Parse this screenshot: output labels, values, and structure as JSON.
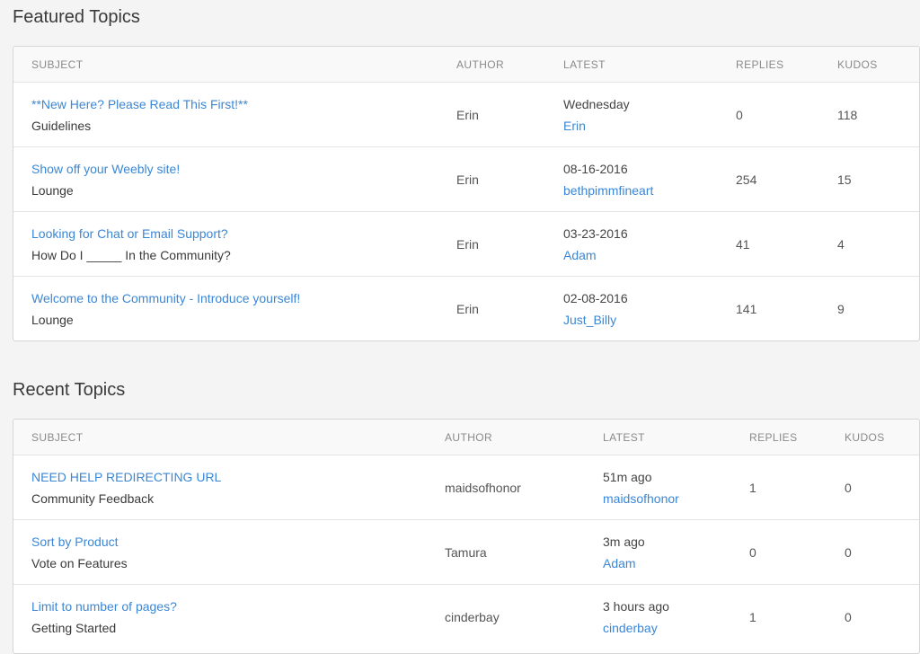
{
  "featured": {
    "title": "Featured Topics",
    "headers": {
      "subject": "SUBJECT",
      "author": "AUTHOR",
      "latest": "LATEST",
      "replies": "REPLIES",
      "kudos": "KUDOS"
    },
    "rows": [
      {
        "subject": "**New Here? Please Read This First!**",
        "board": "Guidelines",
        "author": "Erin",
        "latest_date": "Wednesday",
        "latest_user": "Erin",
        "replies": "0",
        "kudos": "118"
      },
      {
        "subject": "Show off your Weebly site!",
        "board": "Lounge",
        "author": "Erin",
        "latest_date": "08-16-2016",
        "latest_user": "bethpimmfineart",
        "replies": "254",
        "kudos": "15"
      },
      {
        "subject": "Looking for Chat or Email Support?",
        "board": "How Do I _____ In the Community?",
        "author": "Erin",
        "latest_date": "03-23-2016",
        "latest_user": "Adam",
        "replies": "41",
        "kudos": "4"
      },
      {
        "subject": "Welcome to the Community - Introduce yourself!",
        "board": "Lounge",
        "author": "Erin",
        "latest_date": "02-08-2016",
        "latest_user": "Just_Billy",
        "replies": "141",
        "kudos": "9"
      }
    ]
  },
  "recent": {
    "title": "Recent Topics",
    "headers": {
      "subject": "SUBJECT",
      "author": "AUTHOR",
      "latest": "LATEST",
      "replies": "REPLIES",
      "kudos": "KUDOS"
    },
    "rows": [
      {
        "subject": "NEED HELP REDIRECTING URL",
        "board": "Community Feedback",
        "author": "maidsofhonor",
        "latest_date": "51m ago",
        "latest_user": "maidsofhonor",
        "replies": "1",
        "kudos": "0"
      },
      {
        "subject": "Sort by Product",
        "board": "Vote on Features",
        "author": "Tamura",
        "latest_date": "3m ago",
        "latest_user": "Adam",
        "replies": "0",
        "kudos": "0"
      },
      {
        "subject": "Limit to number of pages?",
        "board": "Getting Started",
        "author": "cinderbay",
        "latest_date": "3 hours ago",
        "latest_user": "cinderbay",
        "replies": "1",
        "kudos": "0"
      }
    ]
  },
  "colors": {
    "link": "#3b87d6",
    "text": "#3a3a3a",
    "muted": "#8a8a8a",
    "background": "#f4f4f4"
  }
}
